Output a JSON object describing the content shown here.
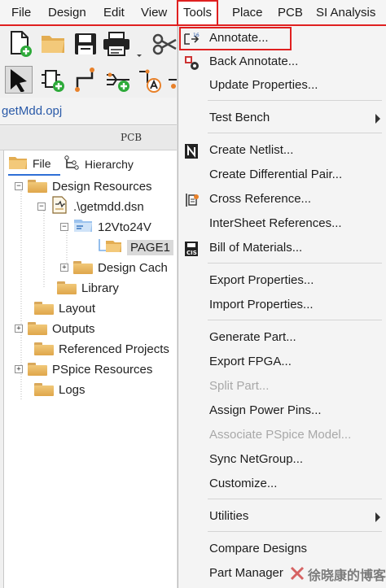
{
  "menubar": {
    "items": [
      {
        "label": "File"
      },
      {
        "label": "Design"
      },
      {
        "label": "Edit"
      },
      {
        "label": "View"
      },
      {
        "label": "Tools",
        "active": true
      },
      {
        "label": "Place"
      },
      {
        "label": "PCB"
      },
      {
        "label": "SI Analysis"
      }
    ]
  },
  "toolbar": {
    "row1": [
      "new-document-icon",
      "open-folder-icon",
      "save-icon",
      "print-icon",
      "cut-icon"
    ],
    "row2": [
      "select-arrow-icon",
      "place-part-icon",
      "place-wire-icon",
      "place-net-group-icon",
      "place-net-alias-icon"
    ]
  },
  "project_tab": {
    "label": "getMdd.opj"
  },
  "pane": {
    "title": "PCB",
    "tabs": [
      {
        "label": "File",
        "icon": "folder-icon"
      },
      {
        "label": "Hierarchy",
        "icon": "hierarchy-icon"
      }
    ],
    "tree": [
      {
        "label": "Design Resources",
        "expander": "−"
      },
      {
        "label": ".\\getmdd.dsn",
        "expander": "−"
      },
      {
        "label": "12Vto24V",
        "expander": "−"
      },
      {
        "label": "PAGE1",
        "selected": true
      },
      {
        "label": "Design Cach",
        "expander": "+"
      },
      {
        "label": "Library"
      },
      {
        "label": "Layout"
      },
      {
        "label": "Outputs",
        "expander": "+"
      },
      {
        "label": "Referenced Projects"
      },
      {
        "label": "PSpice Resources",
        "expander": "+"
      },
      {
        "label": "Logs"
      }
    ]
  },
  "tools_menu": {
    "items": [
      {
        "label": "Annotate...",
        "icon": "annotate-icon",
        "highlighted": true
      },
      {
        "label": "Back Annotate...",
        "icon": "back-annotate-icon"
      },
      {
        "label": "Update Properties..."
      },
      {
        "label": "Test Bench",
        "submenu": true
      },
      {
        "label": "Create Netlist...",
        "icon": "netlist-icon"
      },
      {
        "label": "Create Differential Pair..."
      },
      {
        "label": "Cross Reference...",
        "icon": "cross-reference-icon"
      },
      {
        "label": "InterSheet References..."
      },
      {
        "label": "Bill of Materials...",
        "icon": "bill-of-materials-icon"
      },
      {
        "label": "Export Properties..."
      },
      {
        "label": "Import Properties..."
      },
      {
        "label": "Generate Part..."
      },
      {
        "label": "Export FPGA..."
      },
      {
        "label": "Split Part...",
        "disabled": true
      },
      {
        "label": "Assign Power Pins..."
      },
      {
        "label": "Associate PSpice Model...",
        "disabled": true
      },
      {
        "label": "Sync NetGroup..."
      },
      {
        "label": "Customize..."
      },
      {
        "label": "Utilities",
        "submenu": true
      },
      {
        "label": "Compare Designs"
      },
      {
        "label": "Part Manager"
      }
    ]
  },
  "watermark": {
    "text": "徐晓康的博客"
  },
  "colors": {
    "highlight_red": "#e02020",
    "tab_blue": "#2a5aa8",
    "folder": "#f1c879"
  }
}
